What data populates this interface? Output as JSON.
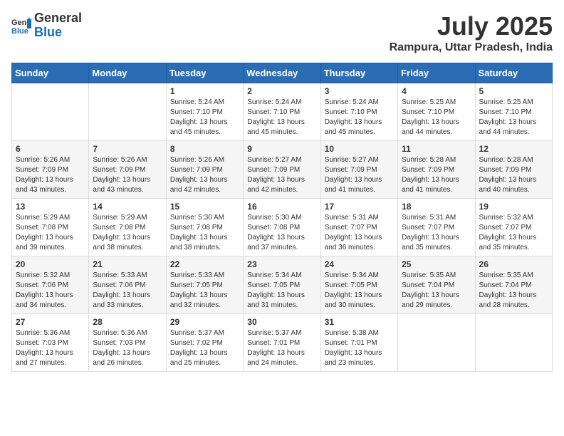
{
  "header": {
    "logo_general": "General",
    "logo_blue": "Blue",
    "month": "July 2025",
    "location": "Rampura, Uttar Pradesh, India"
  },
  "weekdays": [
    "Sunday",
    "Monday",
    "Tuesday",
    "Wednesday",
    "Thursday",
    "Friday",
    "Saturday"
  ],
  "weeks": [
    [
      {
        "day": "",
        "info": ""
      },
      {
        "day": "",
        "info": ""
      },
      {
        "day": "1",
        "sunrise": "Sunrise: 5:24 AM",
        "sunset": "Sunset: 7:10 PM",
        "daylight": "Daylight: 13 hours and 45 minutes."
      },
      {
        "day": "2",
        "sunrise": "Sunrise: 5:24 AM",
        "sunset": "Sunset: 7:10 PM",
        "daylight": "Daylight: 13 hours and 45 minutes."
      },
      {
        "day": "3",
        "sunrise": "Sunrise: 5:24 AM",
        "sunset": "Sunset: 7:10 PM",
        "daylight": "Daylight: 13 hours and 45 minutes."
      },
      {
        "day": "4",
        "sunrise": "Sunrise: 5:25 AM",
        "sunset": "Sunset: 7:10 PM",
        "daylight": "Daylight: 13 hours and 44 minutes."
      },
      {
        "day": "5",
        "sunrise": "Sunrise: 5:25 AM",
        "sunset": "Sunset: 7:10 PM",
        "daylight": "Daylight: 13 hours and 44 minutes."
      }
    ],
    [
      {
        "day": "6",
        "sunrise": "Sunrise: 5:26 AM",
        "sunset": "Sunset: 7:09 PM",
        "daylight": "Daylight: 13 hours and 43 minutes."
      },
      {
        "day": "7",
        "sunrise": "Sunrise: 5:26 AM",
        "sunset": "Sunset: 7:09 PM",
        "daylight": "Daylight: 13 hours and 43 minutes."
      },
      {
        "day": "8",
        "sunrise": "Sunrise: 5:26 AM",
        "sunset": "Sunset: 7:09 PM",
        "daylight": "Daylight: 13 hours and 42 minutes."
      },
      {
        "day": "9",
        "sunrise": "Sunrise: 5:27 AM",
        "sunset": "Sunset: 7:09 PM",
        "daylight": "Daylight: 13 hours and 42 minutes."
      },
      {
        "day": "10",
        "sunrise": "Sunrise: 5:27 AM",
        "sunset": "Sunset: 7:09 PM",
        "daylight": "Daylight: 13 hours and 41 minutes."
      },
      {
        "day": "11",
        "sunrise": "Sunrise: 5:28 AM",
        "sunset": "Sunset: 7:09 PM",
        "daylight": "Daylight: 13 hours and 41 minutes."
      },
      {
        "day": "12",
        "sunrise": "Sunrise: 5:28 AM",
        "sunset": "Sunset: 7:09 PM",
        "daylight": "Daylight: 13 hours and 40 minutes."
      }
    ],
    [
      {
        "day": "13",
        "sunrise": "Sunrise: 5:29 AM",
        "sunset": "Sunset: 7:08 PM",
        "daylight": "Daylight: 13 hours and 39 minutes."
      },
      {
        "day": "14",
        "sunrise": "Sunrise: 5:29 AM",
        "sunset": "Sunset: 7:08 PM",
        "daylight": "Daylight: 13 hours and 38 minutes."
      },
      {
        "day": "15",
        "sunrise": "Sunrise: 5:30 AM",
        "sunset": "Sunset: 7:08 PM",
        "daylight": "Daylight: 13 hours and 38 minutes."
      },
      {
        "day": "16",
        "sunrise": "Sunrise: 5:30 AM",
        "sunset": "Sunset: 7:08 PM",
        "daylight": "Daylight: 13 hours and 37 minutes."
      },
      {
        "day": "17",
        "sunrise": "Sunrise: 5:31 AM",
        "sunset": "Sunset: 7:07 PM",
        "daylight": "Daylight: 13 hours and 36 minutes."
      },
      {
        "day": "18",
        "sunrise": "Sunrise: 5:31 AM",
        "sunset": "Sunset: 7:07 PM",
        "daylight": "Daylight: 13 hours and 35 minutes."
      },
      {
        "day": "19",
        "sunrise": "Sunrise: 5:32 AM",
        "sunset": "Sunset: 7:07 PM",
        "daylight": "Daylight: 13 hours and 35 minutes."
      }
    ],
    [
      {
        "day": "20",
        "sunrise": "Sunrise: 5:32 AM",
        "sunset": "Sunset: 7:06 PM",
        "daylight": "Daylight: 13 hours and 34 minutes."
      },
      {
        "day": "21",
        "sunrise": "Sunrise: 5:33 AM",
        "sunset": "Sunset: 7:06 PM",
        "daylight": "Daylight: 13 hours and 33 minutes."
      },
      {
        "day": "22",
        "sunrise": "Sunrise: 5:33 AM",
        "sunset": "Sunset: 7:05 PM",
        "daylight": "Daylight: 13 hours and 32 minutes."
      },
      {
        "day": "23",
        "sunrise": "Sunrise: 5:34 AM",
        "sunset": "Sunset: 7:05 PM",
        "daylight": "Daylight: 13 hours and 31 minutes."
      },
      {
        "day": "24",
        "sunrise": "Sunrise: 5:34 AM",
        "sunset": "Sunset: 7:05 PM",
        "daylight": "Daylight: 13 hours and 30 minutes."
      },
      {
        "day": "25",
        "sunrise": "Sunrise: 5:35 AM",
        "sunset": "Sunset: 7:04 PM",
        "daylight": "Daylight: 13 hours and 29 minutes."
      },
      {
        "day": "26",
        "sunrise": "Sunrise: 5:35 AM",
        "sunset": "Sunset: 7:04 PM",
        "daylight": "Daylight: 13 hours and 28 minutes."
      }
    ],
    [
      {
        "day": "27",
        "sunrise": "Sunrise: 5:36 AM",
        "sunset": "Sunset: 7:03 PM",
        "daylight": "Daylight: 13 hours and 27 minutes."
      },
      {
        "day": "28",
        "sunrise": "Sunrise: 5:36 AM",
        "sunset": "Sunset: 7:03 PM",
        "daylight": "Daylight: 13 hours and 26 minutes."
      },
      {
        "day": "29",
        "sunrise": "Sunrise: 5:37 AM",
        "sunset": "Sunset: 7:02 PM",
        "daylight": "Daylight: 13 hours and 25 minutes."
      },
      {
        "day": "30",
        "sunrise": "Sunrise: 5:37 AM",
        "sunset": "Sunset: 7:01 PM",
        "daylight": "Daylight: 13 hours and 24 minutes."
      },
      {
        "day": "31",
        "sunrise": "Sunrise: 5:38 AM",
        "sunset": "Sunset: 7:01 PM",
        "daylight": "Daylight: 13 hours and 23 minutes."
      },
      {
        "day": "",
        "info": ""
      },
      {
        "day": "",
        "info": ""
      }
    ]
  ]
}
